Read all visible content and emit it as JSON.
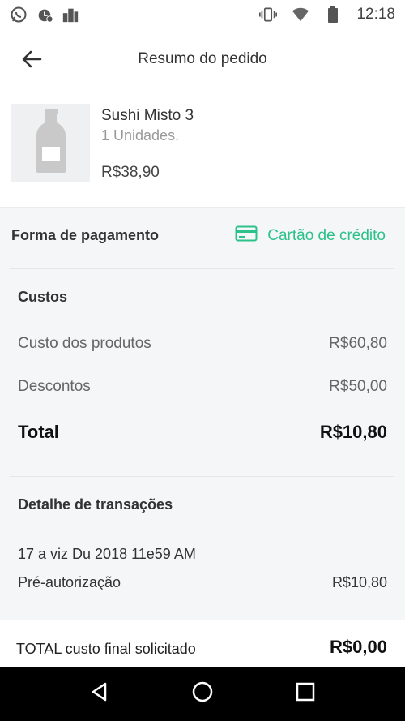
{
  "status_bar": {
    "time": "12:18",
    "left_icons": [
      "whatsapp-icon",
      "alarm-icon",
      "buildings-icon"
    ],
    "right_icons": [
      "vibrate-icon",
      "wifi-icon",
      "battery-icon"
    ]
  },
  "app_bar": {
    "title": "Resumo do pedido",
    "back_icon": "arrow-left-icon"
  },
  "product": {
    "name": "Sushi Misto 3",
    "quantity": "1 Unidades.",
    "price": "R$38,90",
    "image_icon": "bottle-icon"
  },
  "payment": {
    "label": "Forma de pagamento",
    "method": "Cartão de crédito",
    "method_icon": "credit-card-icon",
    "accent_color": "#2cc28a"
  },
  "costs": {
    "title": "Custos",
    "products_label": "Custo dos produtos",
    "products_value": "R$60,80",
    "discounts_label": "Descontos",
    "discounts_value": "R$50,00",
    "total_label": "Total",
    "total_value": "R$10,80"
  },
  "transactions": {
    "title": "Detalhe de transações",
    "date": "17 a viz Du 2018 11e59 AM",
    "type_label": "Pré-autorização",
    "type_value": "R$10,80"
  },
  "footer": {
    "label": "TOTAL custo final solicitado",
    "value": "R$0,00"
  },
  "nav_bar": {
    "buttons": [
      "back-triangle-icon",
      "home-circle-icon",
      "recents-square-icon"
    ]
  }
}
